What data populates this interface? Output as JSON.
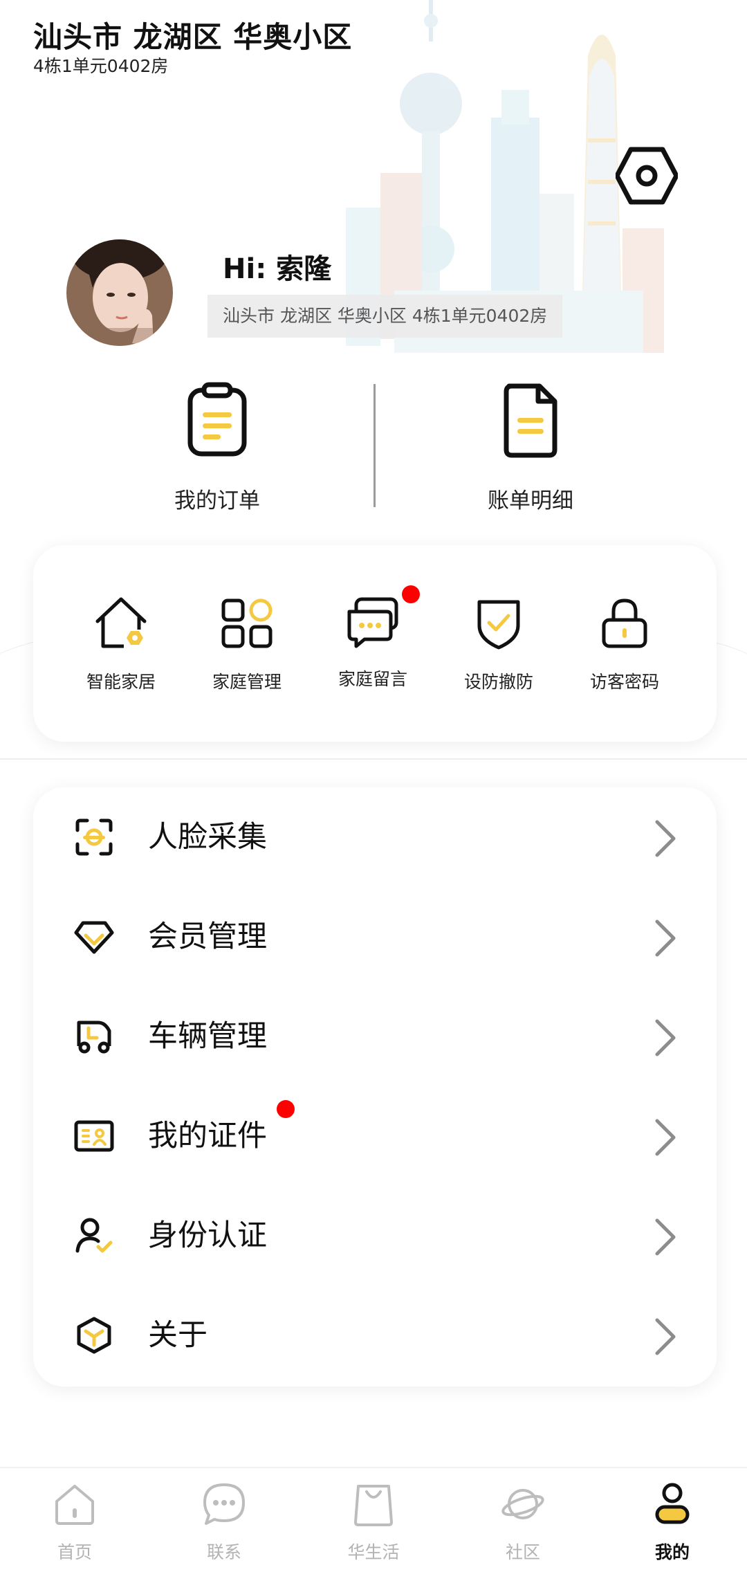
{
  "header": {
    "title": "汕头市 龙湖区 华奥小区",
    "subtitle": "4栋1单元0402房"
  },
  "profile": {
    "greeting": "Hi: 索隆",
    "address": "汕头市 龙湖区 华奥小区 4栋1单元0402房"
  },
  "quick_actions": [
    {
      "label": "我的订单",
      "icon": "clipboard-icon"
    },
    {
      "label": "账单明细",
      "icon": "document-icon"
    }
  ],
  "tools": [
    {
      "label": "智能家居",
      "icon": "smart-home-icon",
      "badge": false
    },
    {
      "label": "家庭管理",
      "icon": "grid-icon",
      "badge": false
    },
    {
      "label": "家庭留言",
      "icon": "message-icon",
      "badge": true
    },
    {
      "label": "设防撤防",
      "icon": "shield-icon",
      "badge": false
    },
    {
      "label": "访客密码",
      "icon": "lock-icon",
      "badge": false
    }
  ],
  "menu": [
    {
      "label": "人脸采集",
      "icon": "face-scan-icon",
      "badge": false
    },
    {
      "label": "会员管理",
      "icon": "diamond-icon",
      "badge": false
    },
    {
      "label": "车辆管理",
      "icon": "vehicle-icon",
      "badge": false
    },
    {
      "label": "我的证件",
      "icon": "id-card-icon",
      "badge": true
    },
    {
      "label": "身份认证",
      "icon": "user-verify-icon",
      "badge": false
    },
    {
      "label": "关于",
      "icon": "cube-icon",
      "badge": false
    }
  ],
  "tabs": [
    {
      "label": "首页",
      "icon": "home-icon",
      "active": false
    },
    {
      "label": "联系",
      "icon": "chat-icon",
      "active": false
    },
    {
      "label": "华生活",
      "icon": "shopping-bag-icon",
      "active": false
    },
    {
      "label": "社区",
      "icon": "planet-icon",
      "active": false
    },
    {
      "label": "我的",
      "icon": "person-icon",
      "active": true
    }
  ],
  "colors": {
    "accent": "#F5C842",
    "badge": "#FF0000",
    "text_primary": "#111111",
    "tab_inactive": "#B3B3B3"
  }
}
